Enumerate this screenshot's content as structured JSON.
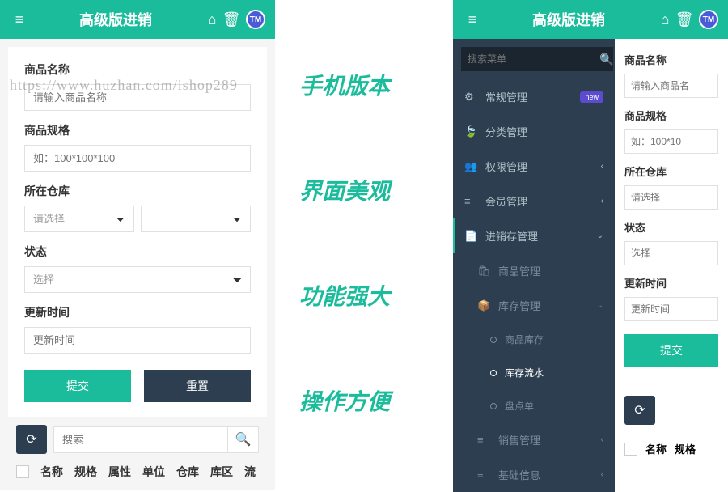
{
  "watermark": "https://www.huzhan.com/ishop289",
  "header": {
    "title": "高级版进销",
    "badge": "TM"
  },
  "promo": [
    "手机版本",
    "界面美观",
    "功能强大",
    "操作方便"
  ],
  "form": {
    "name_label": "商品名称",
    "name_placeholder": "请输入商品名称",
    "spec_label": "商品规格",
    "spec_placeholder": "如：100*100*100",
    "warehouse_label": "所在仓库",
    "warehouse_placeholder": "请选择",
    "status_label": "状态",
    "status_placeholder": "选择",
    "time_label": "更新时间",
    "time_placeholder": "更新时间",
    "submit": "提交",
    "reset": "重置"
  },
  "search": {
    "placeholder": "搜索"
  },
  "table_cols": [
    "名称",
    "规格",
    "属性",
    "单位",
    "仓库",
    "库区",
    "流"
  ],
  "sidebar": {
    "search_placeholder": "搜索菜单",
    "items": [
      {
        "icon": "⚙",
        "label": "常规管理",
        "badge": "new"
      },
      {
        "icon": "🍃",
        "label": "分类管理"
      },
      {
        "icon": "👥",
        "label": "权限管理",
        "chevron": "‹"
      },
      {
        "icon": "≡",
        "label": "会员管理",
        "chevron": "‹"
      },
      {
        "icon": "📄",
        "label": "进销存管理",
        "chevron": "⌄",
        "active": true
      }
    ],
    "subs": [
      {
        "icon": "🛍",
        "label": "商品管理"
      },
      {
        "icon": "📦",
        "label": "库存管理",
        "chevron": "⌄"
      }
    ],
    "subs2": [
      {
        "label": "商品库存"
      },
      {
        "label": "库存流水",
        "active": true
      },
      {
        "label": "盘点单"
      }
    ],
    "tail": [
      {
        "icon": "≡",
        "label": "销售管理",
        "chevron": "‹"
      },
      {
        "icon": "≡",
        "label": "基础信息",
        "chevron": "‹"
      }
    ]
  },
  "right_form": {
    "name_label": "商品名称",
    "name_placeholder": "请输入商品名",
    "spec_label": "商品规格",
    "spec_placeholder": "如：100*10",
    "warehouse_label": "所在仓库",
    "warehouse_placeholder": "请选择",
    "status_label": "状态",
    "status_placeholder": "选择",
    "time_label": "更新时间",
    "time_placeholder": "更新时间",
    "submit": "提交"
  },
  "right_cols": [
    "名称",
    "规格"
  ]
}
